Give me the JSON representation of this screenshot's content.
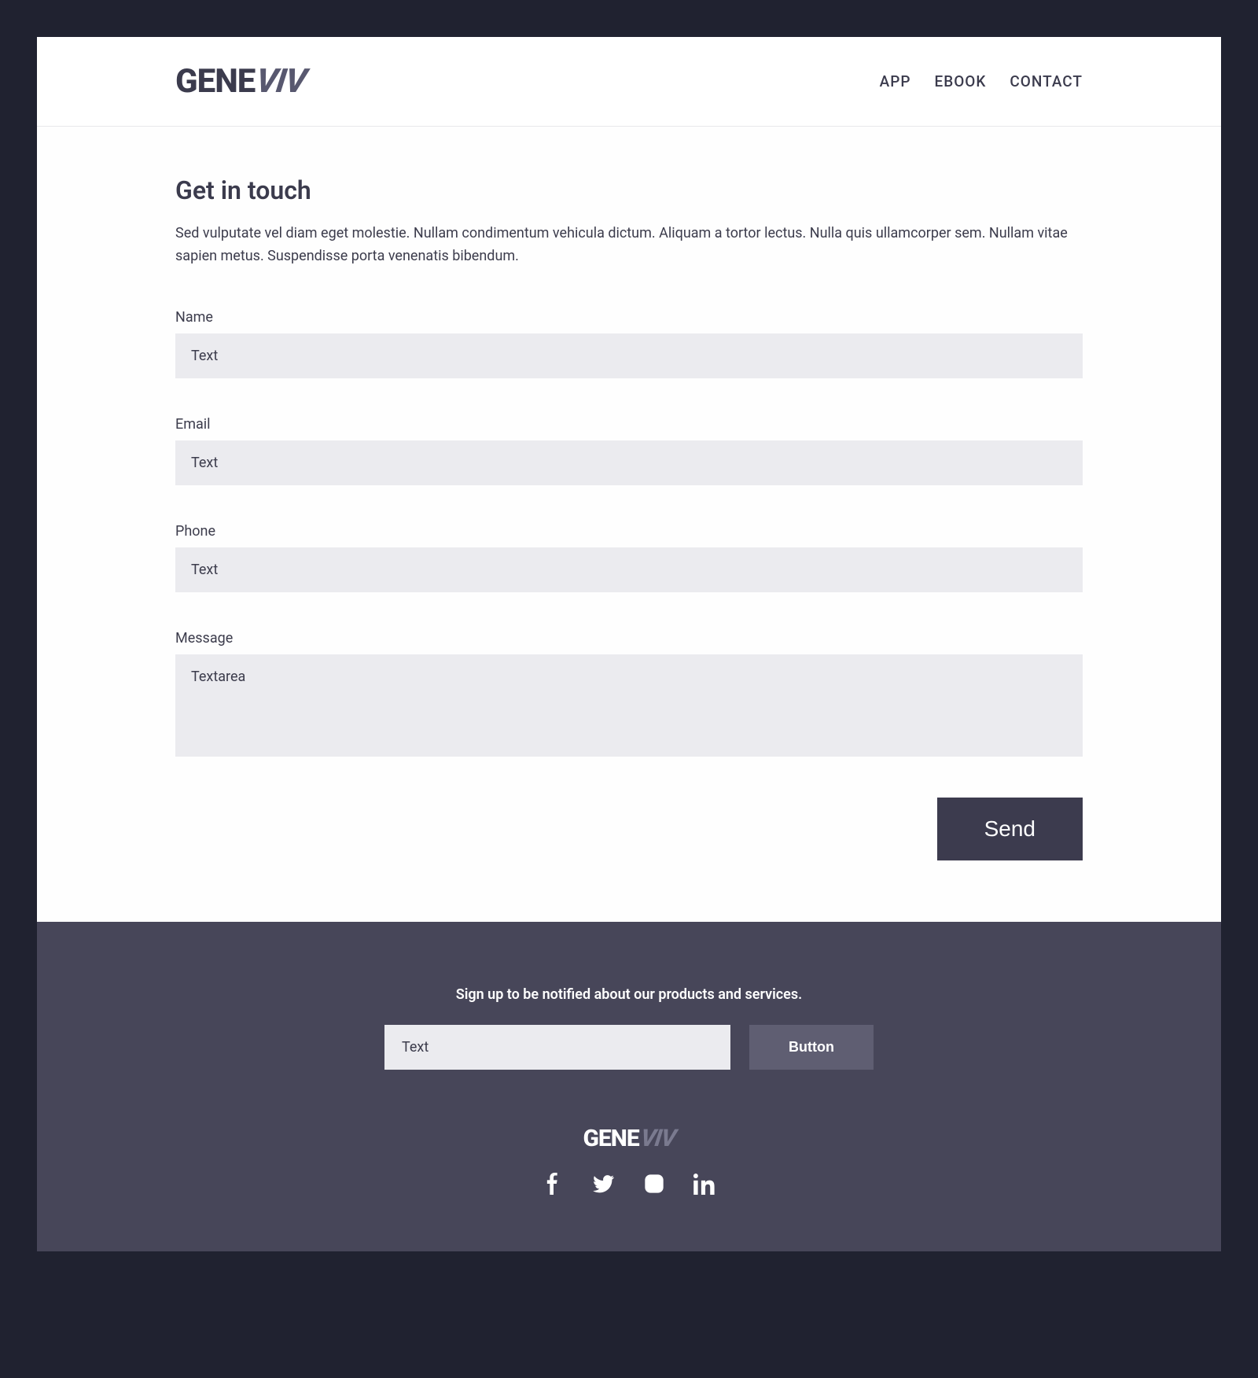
{
  "brand": {
    "part1": "GENE",
    "part2": "VIV"
  },
  "nav": {
    "items": [
      "APP",
      "EBOOK",
      "CONTACT"
    ]
  },
  "page": {
    "title": "Get in touch",
    "intro": "Sed vulputate vel diam eget molestie. Nullam condimentum vehicula dictum. Aliquam a tortor lectus. Nulla quis ullamcorper sem. Nullam vitae sapien metus. Suspendisse porta venenatis bibendum."
  },
  "form": {
    "name": {
      "label": "Name",
      "placeholder": "Text"
    },
    "email": {
      "label": "Email",
      "placeholder": "Text"
    },
    "phone": {
      "label": "Phone",
      "placeholder": "Text"
    },
    "message": {
      "label": "Message",
      "placeholder": "Textarea"
    },
    "submit": "Send"
  },
  "footer": {
    "signup_text": "Sign up to be notified about our products and services.",
    "input_placeholder": "Text",
    "button_label": "Button"
  }
}
